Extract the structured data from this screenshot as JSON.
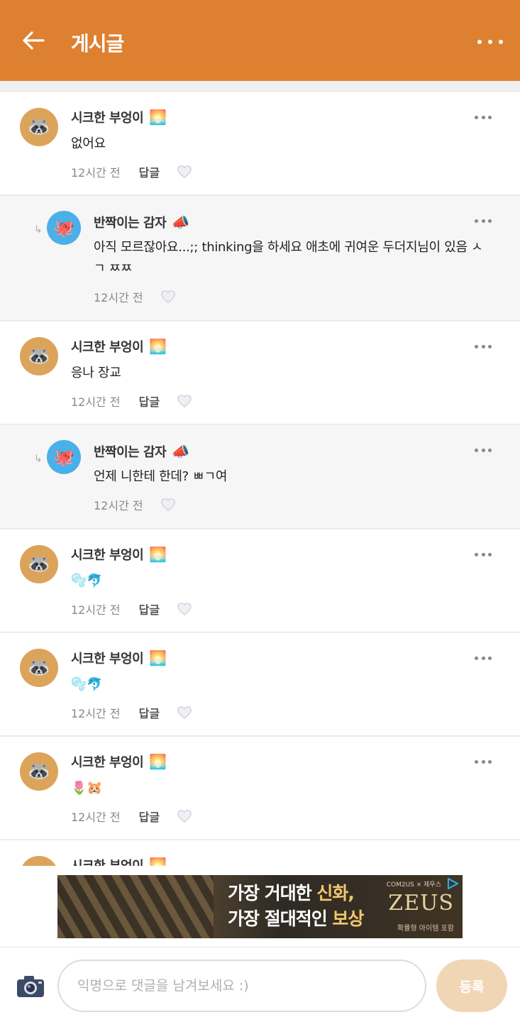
{
  "header": {
    "title": "게시글",
    "back_icon": "arrow-left-icon",
    "menu_icon": "more-horizontal-icon",
    "background": "#dd8130"
  },
  "comments": [
    {
      "type": "comment",
      "author": "시크한 부엉이",
      "badge": "🌅",
      "avatar": "🦝",
      "text": "없어요",
      "time": "12시간 전",
      "reply_label": "답글"
    },
    {
      "type": "reply",
      "author": "반짝이는 감자",
      "badge": "📣",
      "avatar": "🐙",
      "text": "아직 모르잖아요...;; thinking을 하세요 애초에 귀여운 두더지님이 있음 ㅅㄱ ㅉㅉ",
      "time": "12시간 전"
    },
    {
      "type": "comment",
      "author": "시크한 부엉이",
      "badge": "🌅",
      "avatar": "🦝",
      "text": "응나 장교",
      "time": "12시간 전",
      "reply_label": "답글"
    },
    {
      "type": "reply",
      "author": "반짝이는 감자",
      "badge": "📣",
      "avatar": "🐙",
      "text": "언제 니한테 한데? ㅃㄱ여",
      "time": "12시간 전"
    },
    {
      "type": "comment",
      "author": "시크한 부엉이",
      "badge": "🌅",
      "avatar": "🦝",
      "text": "🫧🐬",
      "time": "12시간 전",
      "reply_label": "답글"
    },
    {
      "type": "comment",
      "author": "시크한 부엉이",
      "badge": "🌅",
      "avatar": "🦝",
      "text": "🫧🐬",
      "time": "12시간 전",
      "reply_label": "답글"
    },
    {
      "type": "comment",
      "author": "시크한 부엉이",
      "badge": "🌅",
      "avatar": "🦝",
      "text": "🌷🐹",
      "time": "12시간 전",
      "reply_label": "답글"
    },
    {
      "type": "comment",
      "author": "시크한 부엉이",
      "badge": "🌅",
      "avatar": "🦝",
      "text": "",
      "time": "",
      "reply_label": ""
    }
  ],
  "ad": {
    "line1_prefix": "가장 거대한 ",
    "line1_highlight": "신화,",
    "line2_prefix": "가장 절대적인 ",
    "line2_highlight": "보상",
    "brand": "ZEUS",
    "top_text": "COM2US × 제우스",
    "sub_text": "확률형 아이템 포함"
  },
  "composer": {
    "placeholder": "익명으로 댓글을 남겨보세요 :)",
    "value": "",
    "submit_label": "등록",
    "camera_icon": "camera-icon"
  }
}
